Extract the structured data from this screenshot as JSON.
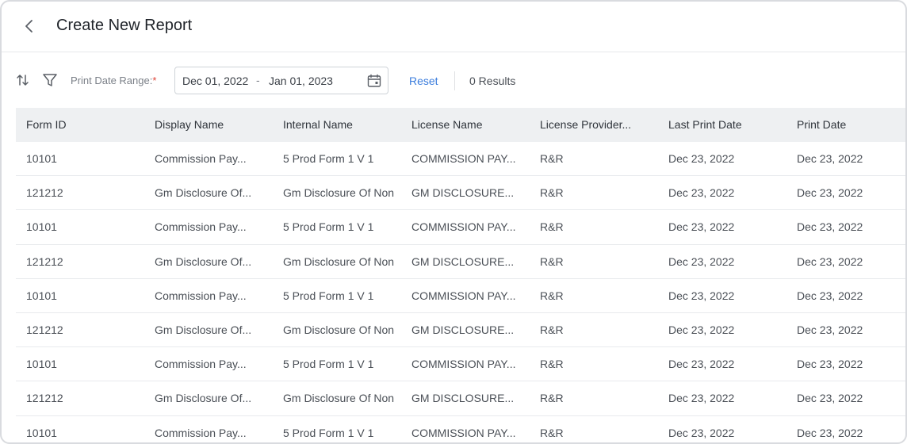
{
  "header": {
    "title": "Create New Report",
    "back_icon": "chevron-left-icon"
  },
  "toolbar": {
    "sort_icon": "sort-icon",
    "filter_icon": "filter-icon",
    "range_label": "Print Date Range:",
    "required_mark": "*",
    "date_start": "Dec 01, 2022",
    "date_separator": "-",
    "date_end": "Jan 01, 2023",
    "calendar_icon": "calendar-icon",
    "reset_label": "Reset",
    "results_label": "0 Results"
  },
  "table": {
    "columns": [
      "Form ID",
      "Display Name",
      "Internal Name",
      "License Name",
      "License Provider...",
      "Last Print Date",
      "Print Date"
    ],
    "rows": [
      [
        "10101",
        "Commission Pay...",
        "5 Prod Form 1 V 1",
        "COMMISSION PAY...",
        "R&R",
        "Dec 23, 2022",
        "Dec 23, 2022"
      ],
      [
        "121212",
        "Gm Disclosure Of...",
        "Gm Disclosure Of Non",
        "GM DISCLOSURE...",
        "R&R",
        "Dec 23, 2022",
        "Dec 23, 2022"
      ],
      [
        "10101",
        "Commission Pay...",
        "5 Prod Form 1 V 1",
        "COMMISSION PAY...",
        "R&R",
        "Dec 23, 2022",
        "Dec 23, 2022"
      ],
      [
        "121212",
        "Gm Disclosure Of...",
        "Gm Disclosure Of Non",
        "GM DISCLOSURE...",
        "R&R",
        "Dec 23, 2022",
        "Dec 23, 2022"
      ],
      [
        "10101",
        "Commission Pay...",
        "5 Prod Form 1 V 1",
        "COMMISSION PAY...",
        "R&R",
        "Dec 23, 2022",
        "Dec 23, 2022"
      ],
      [
        "121212",
        "Gm Disclosure Of...",
        "Gm Disclosure Of Non",
        "GM DISCLOSURE...",
        "R&R",
        "Dec 23, 2022",
        "Dec 23, 2022"
      ],
      [
        "10101",
        "Commission Pay...",
        "5 Prod Form 1 V 1",
        "COMMISSION PAY...",
        "R&R",
        "Dec 23, 2022",
        "Dec 23, 2022"
      ],
      [
        "121212",
        "Gm Disclosure Of...",
        "Gm Disclosure Of Non",
        "GM DISCLOSURE...",
        "R&R",
        "Dec 23, 2022",
        "Dec 23, 2022"
      ],
      [
        "10101",
        "Commission Pay...",
        "5 Prod Form 1 V 1",
        "COMMISSION PAY...",
        "R&R",
        "Dec 23, 2022",
        "Dec 23, 2022"
      ]
    ]
  },
  "colors": {
    "accent": "#3b7ddd",
    "required": "#e0453a",
    "header_bg": "#eef0f2"
  }
}
